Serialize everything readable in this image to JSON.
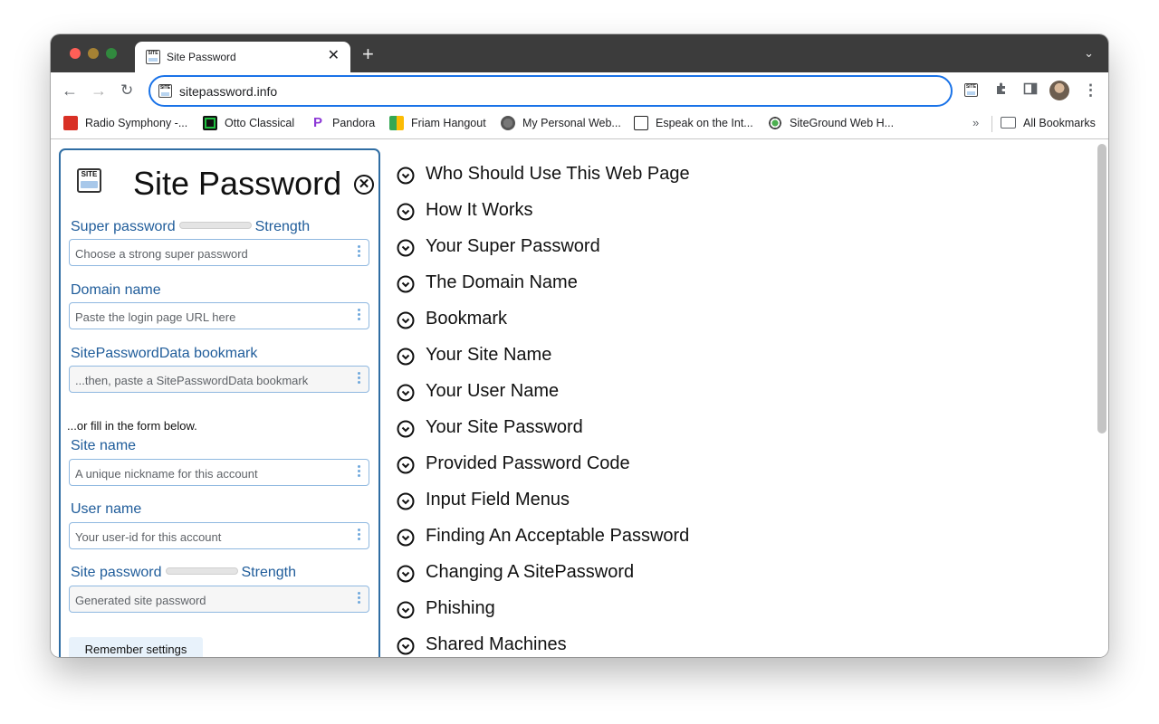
{
  "browser": {
    "tab_title": "Site Password",
    "tab_close": "✕",
    "new_tab": "+",
    "url": "sitepassword.info",
    "bookmarks": [
      {
        "label": "Radio Symphony -...",
        "icon": "radio-icon"
      },
      {
        "label": "Otto Classical",
        "icon": "otto-icon"
      },
      {
        "label": "Pandora",
        "icon": "pandora-icon"
      },
      {
        "label": "Friam Hangout",
        "icon": "meet-icon"
      },
      {
        "label": "My Personal Web...",
        "icon": "globe-icon"
      },
      {
        "label": "Espeak on the Int...",
        "icon": "library-icon"
      },
      {
        "label": "SiteGround Web H...",
        "icon": "siteground-icon"
      }
    ],
    "bookmarks_more": "»",
    "all_bookmarks": "All Bookmarks"
  },
  "panel": {
    "logo_text": "SITE",
    "title": "Site Password",
    "close_glyph": "✕",
    "super_password": {
      "label": "Super password",
      "strength": "Strength",
      "placeholder": "Choose a strong super password"
    },
    "domain": {
      "label": "Domain name",
      "placeholder": "Paste the login page URL here"
    },
    "bookmark": {
      "label": "SitePasswordData bookmark",
      "placeholder": "...then, paste a SitePasswordData bookmark"
    },
    "or_fill": "...or fill in the form below.",
    "site_name": {
      "label": "Site name",
      "placeholder": "A unique nickname for this account"
    },
    "user_name": {
      "label": "User name",
      "placeholder": "Your user-id for this account"
    },
    "site_password": {
      "label": "Site password",
      "strength": "Strength",
      "placeholder": "Generated site password"
    },
    "remember": "Remember settings"
  },
  "help_sections": [
    "Who Should Use This Web Page",
    "How It Works",
    "Your Super Password",
    "The Domain Name",
    "Bookmark",
    "Your Site Name",
    "Your User Name",
    "Your Site Password",
    "Provided Password Code",
    "Input Field Menus",
    "Finding An Acceptable Password",
    "Changing A SitePassword",
    "Phishing",
    "Shared Machines"
  ]
}
